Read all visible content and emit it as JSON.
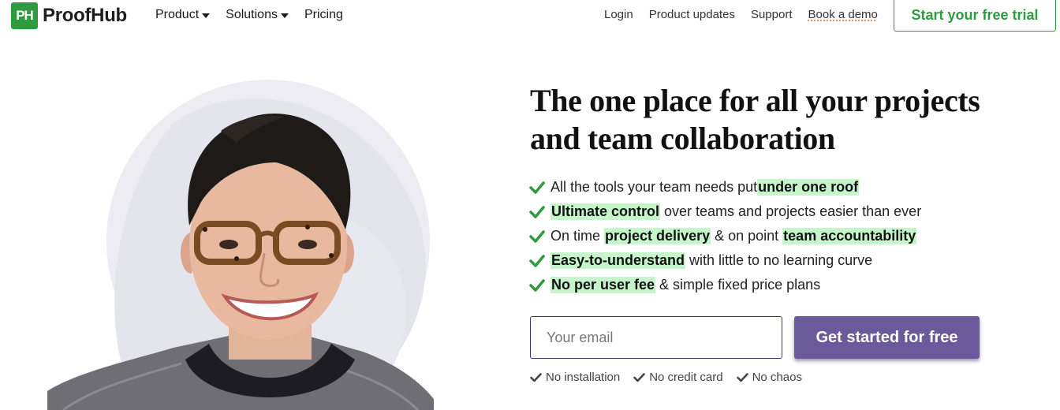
{
  "brand": {
    "mark": "PH",
    "name": "ProofHub",
    "accent": "#2e9b3e",
    "cta_color": "#6a5a9b",
    "highlight": "#c6f5cc"
  },
  "nav": {
    "left": [
      {
        "label": "Product",
        "has_caret": true
      },
      {
        "label": "Solutions",
        "has_caret": true
      },
      {
        "label": "Pricing",
        "has_caret": false
      }
    ],
    "right": [
      "Login",
      "Product updates",
      "Support",
      "Book a demo"
    ],
    "cta": "Start your free trial"
  },
  "hero": {
    "headline": "The one place for all your projects and team collaboration",
    "features": [
      {
        "before": "All the tools your team needs put ",
        "highlight": "under one roof",
        "after": ""
      },
      {
        "before": "",
        "highlight": "Ultimate control",
        "after": " over teams and projects easier than ever"
      },
      {
        "before": "On time ",
        "highlight": "project delivery",
        "after": " & on point ",
        "highlight2": "team accountability"
      },
      {
        "before": "",
        "highlight": "Easy-to-understand",
        "after": " with little to no learning curve"
      },
      {
        "before": "",
        "highlight": "No per user fee",
        "after": " & simple fixed price plans"
      }
    ],
    "email_placeholder": "Your email",
    "submit_label": "Get started for free",
    "perks": [
      "No installation",
      "No credit card",
      "No chaos"
    ],
    "image": {
      "subject": "smiling-woman-with-glasses-portrait"
    }
  }
}
